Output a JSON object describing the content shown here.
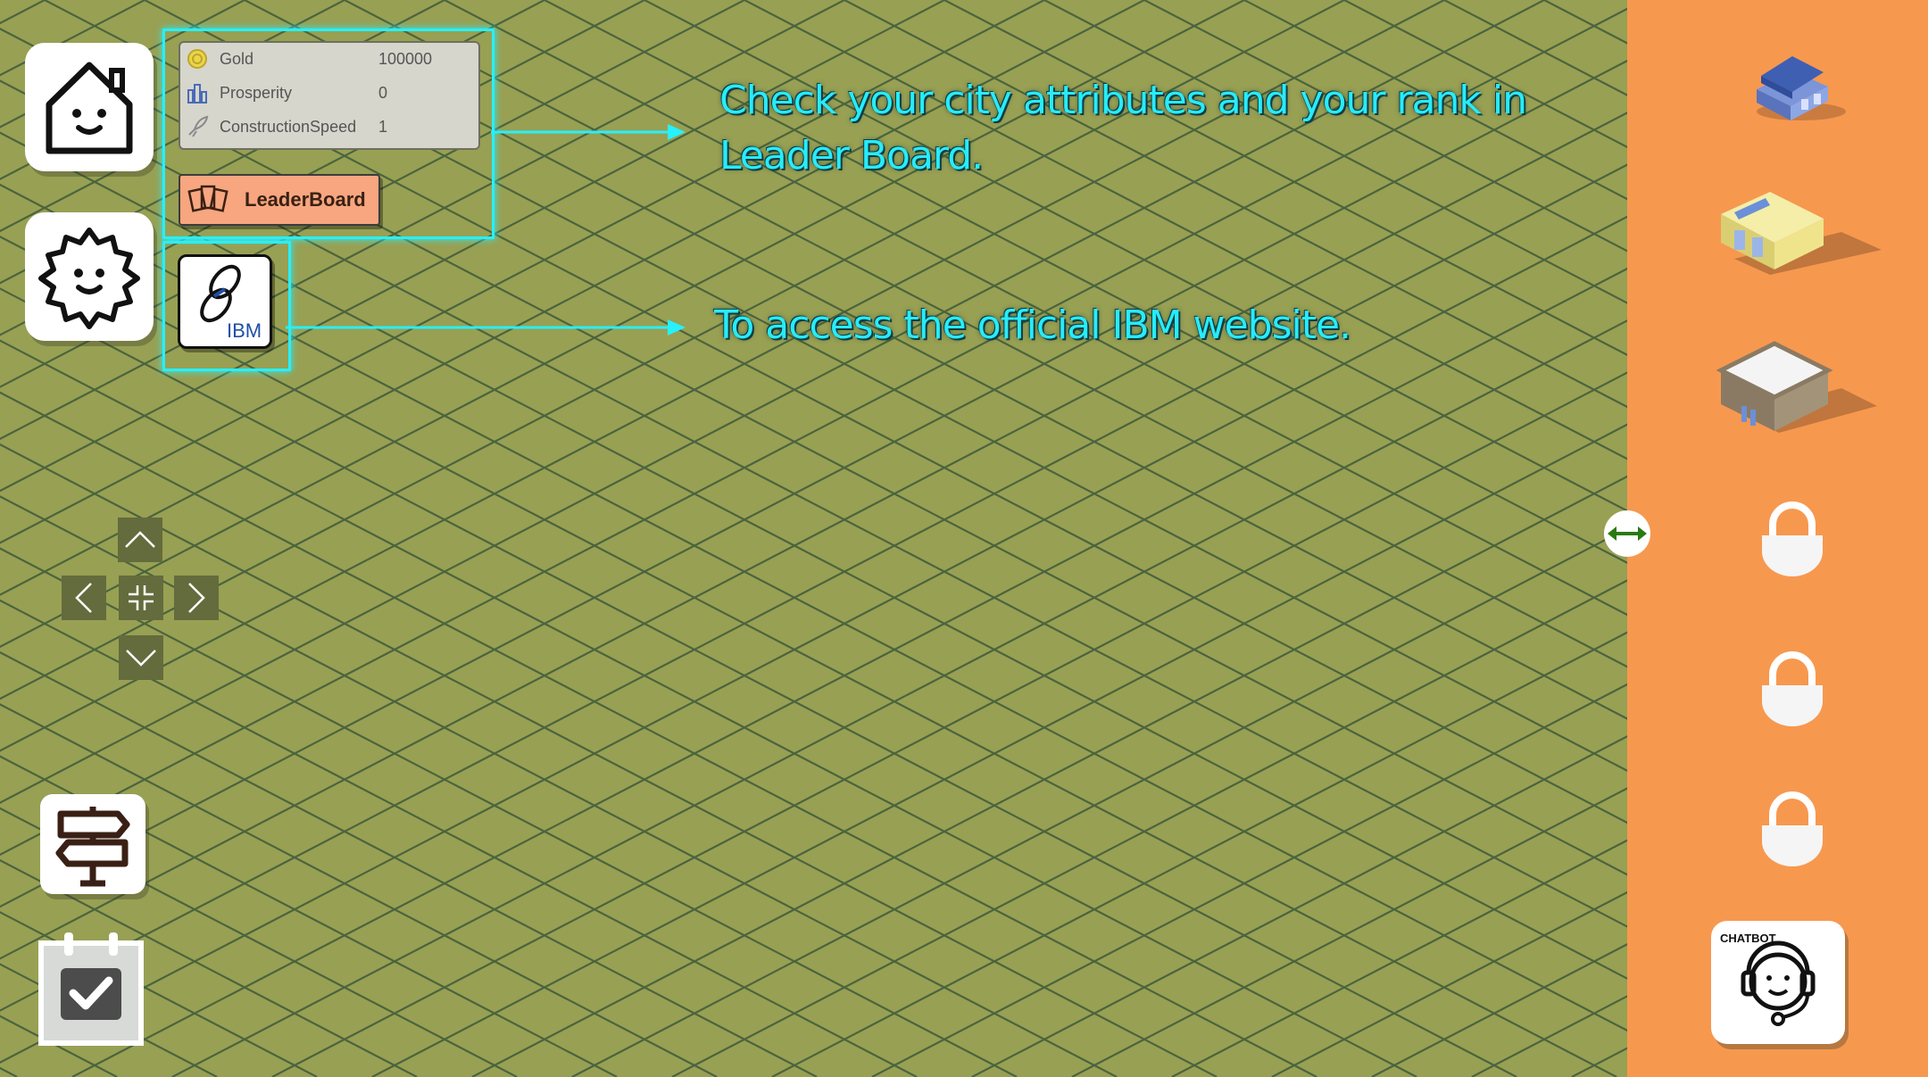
{
  "stats": [
    {
      "label": "Gold",
      "value": "100000",
      "icon": "gold-coin-icon"
    },
    {
      "label": "Prosperity",
      "value": "0",
      "icon": "city-buildings-icon"
    },
    {
      "label": "ConstructionSpeed",
      "value": "1",
      "icon": "rocket-icon"
    }
  ],
  "leaderboard": {
    "label": "LeaderBoard",
    "icon": "cards-icon"
  },
  "ibm_link": {
    "text": "IBM",
    "icon": "link-icon"
  },
  "callouts": {
    "attributes_line1": "Check your city attributes and your rank in",
    "attributes_line2": "Leader Board.",
    "ibm": "To access the official IBM website."
  },
  "chatbot": {
    "label": "CHATBOT",
    "icon": "support-agent-icon"
  },
  "colors": {
    "ground": "#98a053",
    "grid": "#3e5a3a",
    "sidebar": "#f7984f",
    "highlight": "#27f0ff"
  }
}
